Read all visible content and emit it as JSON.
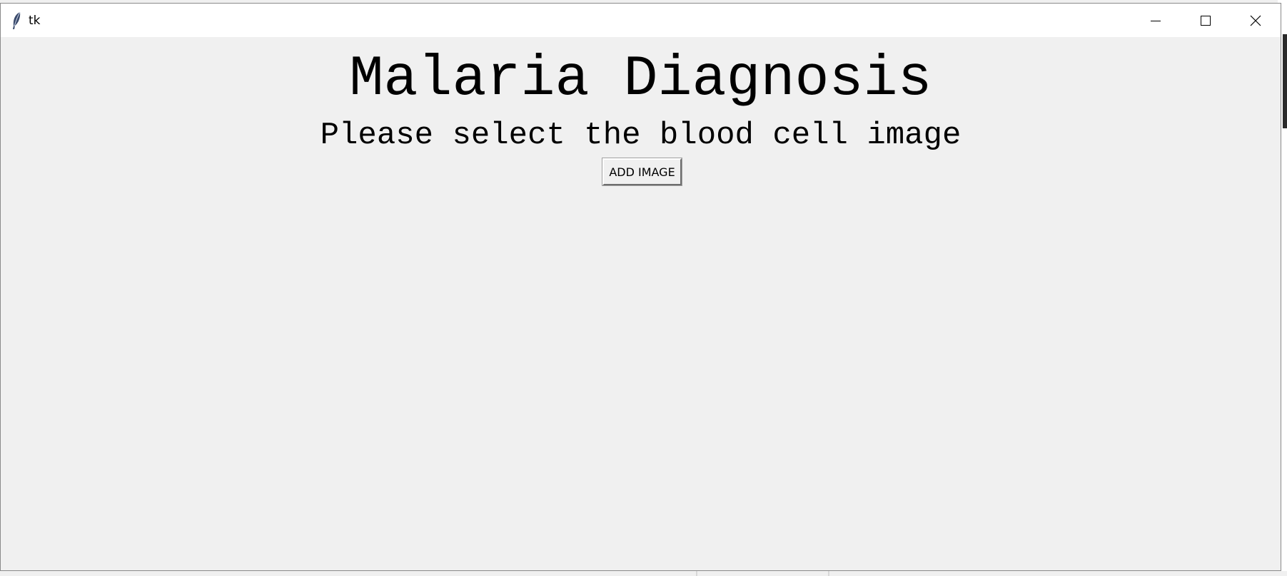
{
  "window": {
    "title": "tk",
    "icon": "feather-icon",
    "controls": {
      "minimize": "minimize-icon",
      "maximize": "maximize-icon",
      "close": "close-icon"
    }
  },
  "content": {
    "title": "Malaria Diagnosis",
    "subtitle": "Please select the blood cell image",
    "add_button_label": "ADD IMAGE"
  },
  "colors": {
    "window_bg": "#f0f0f0",
    "titlebar_bg": "#ffffff",
    "text": "#000000"
  }
}
